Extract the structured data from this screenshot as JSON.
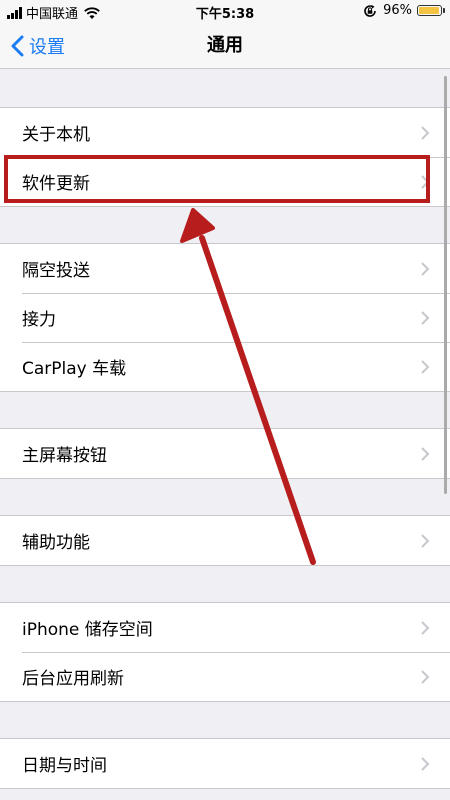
{
  "status_bar": {
    "carrier": "中国联通",
    "time": "下午5:38",
    "battery_percent": "96%",
    "battery_level": 0.96,
    "battery_color": "#f5c344"
  },
  "nav": {
    "back_label": "设置",
    "title": "通用",
    "accent_color": "#1a7cf5"
  },
  "groups": [
    {
      "items": [
        {
          "label": "关于本机",
          "icon": "chevron-right-icon"
        },
        {
          "label": "软件更新",
          "icon": "chevron-right-icon"
        }
      ]
    },
    {
      "items": [
        {
          "label": "隔空投送",
          "icon": "chevron-right-icon"
        },
        {
          "label": "接力",
          "icon": "chevron-right-icon"
        },
        {
          "label": "CarPlay 车载",
          "icon": "chevron-right-icon"
        }
      ]
    },
    {
      "items": [
        {
          "label": "主屏幕按钮",
          "icon": "chevron-right-icon"
        }
      ]
    },
    {
      "items": [
        {
          "label": "辅助功能",
          "icon": "chevron-right-icon"
        }
      ]
    },
    {
      "items": [
        {
          "label": "iPhone 储存空间",
          "icon": "chevron-right-icon"
        },
        {
          "label": "后台应用刷新",
          "icon": "chevron-right-icon"
        }
      ]
    },
    {
      "items": [
        {
          "label": "日期与时间",
          "icon": "chevron-right-icon"
        }
      ]
    }
  ],
  "annotation": {
    "highlight_color": "#b81d1d",
    "highlighted_item": "软件更新"
  }
}
